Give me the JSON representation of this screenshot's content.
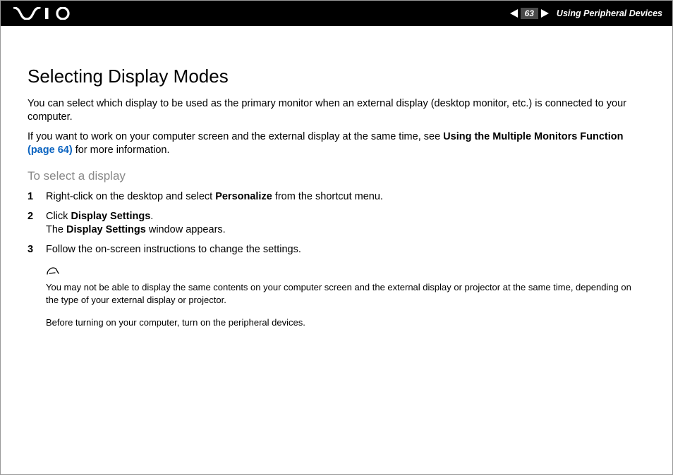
{
  "header": {
    "page_number": "63",
    "section": "Using Peripheral Devices"
  },
  "content": {
    "title": "Selecting Display Modes",
    "intro1": "You can select which display to be used as the primary monitor when an external display (desktop monitor, etc.) is connected to your computer.",
    "intro2_a": "If you want to work on your computer screen and the external display at the same time, see ",
    "intro2_bold": "Using the Multiple Monitors Function ",
    "intro2_link": "(page 64)",
    "intro2_b": " for more information.",
    "subheading": "To select a display",
    "steps": [
      {
        "num": "1",
        "pre": "Right-click on the desktop and select ",
        "bold": "Personalize",
        "post": " from the shortcut menu."
      },
      {
        "num": "2",
        "line1_pre": "Click ",
        "line1_bold": "Display Settings",
        "line1_post": ".",
        "line2_pre": "The ",
        "line2_bold": "Display Settings",
        "line2_post": " window appears."
      },
      {
        "num": "3",
        "text": "Follow the on-screen instructions to change the settings."
      }
    ],
    "note1": "You may not be able to display the same contents on your computer screen and the external display or projector at the same time, depending on the type of your external display or projector.",
    "note2": "Before turning on your computer, turn on the peripheral devices."
  }
}
